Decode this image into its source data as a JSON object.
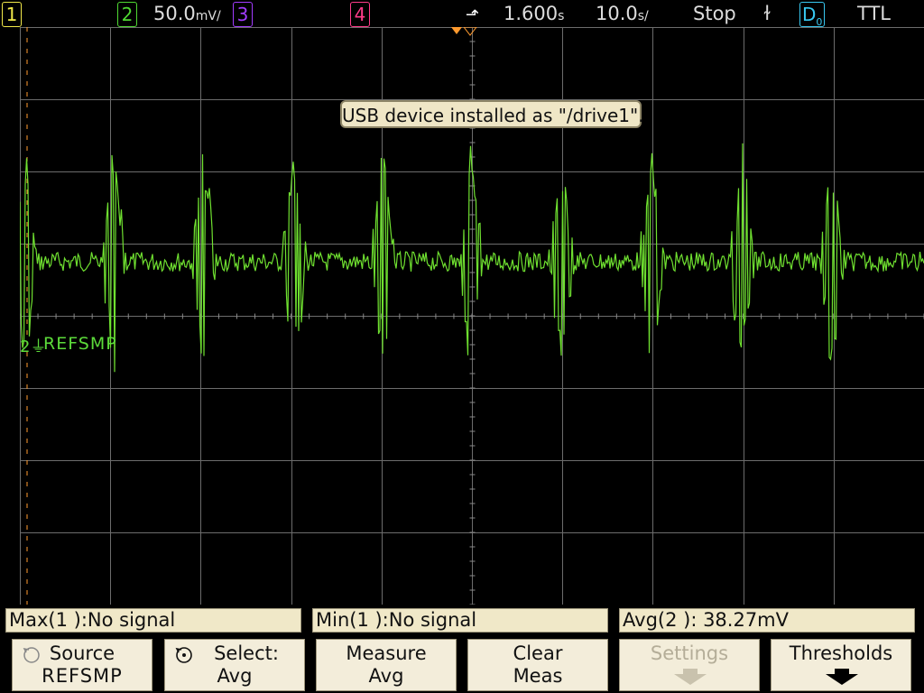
{
  "topbar": {
    "ch1": "1",
    "ch2": "2",
    "ch2_scale": "50.0",
    "ch2_scale_unit": "mV/",
    "ch3": "3",
    "ch4": "4",
    "trigger_time": "1.600",
    "trigger_time_unit": "s",
    "time_scale": "10.0",
    "time_scale_unit": "s/",
    "run_state": "Stop",
    "trigger_slope": "ɫ",
    "digital": "D",
    "digital_sub": "0",
    "logic": "TTL",
    "colors": {
      "ch1": "#f2e94a",
      "ch2": "#4fd832",
      "ch3": "#a23cff",
      "ch4": "#ff3c8a",
      "digital": "#38c8f0"
    }
  },
  "screen": {
    "toast": "USB device installed as \"/drive1\".",
    "ref_marker": "2",
    "ref_label": "REFSMP",
    "trace_color": "#6fe030"
  },
  "measurements": {
    "max": "Max(1 ):No signal",
    "min": "Min(1 ):No signal",
    "avg": "Avg(2 ): 38.27mV"
  },
  "softkeys": [
    {
      "line1": "Source",
      "line2": "REFSMP",
      "icon": "knob-icon",
      "disabled": false
    },
    {
      "line1": "Select:",
      "line2": "Avg",
      "icon": "knob-icon",
      "disabled": false
    },
    {
      "line1": "Measure",
      "line2": "Avg",
      "disabled": false
    },
    {
      "line1": "Clear",
      "line2": "Meas",
      "disabled": false
    },
    {
      "line1": "Settings",
      "line2": "",
      "icon": "arrow-down-icon",
      "disabled": true
    },
    {
      "line1": "Thresholds",
      "line2": "",
      "icon": "arrow-down-icon",
      "disabled": false
    }
  ]
}
